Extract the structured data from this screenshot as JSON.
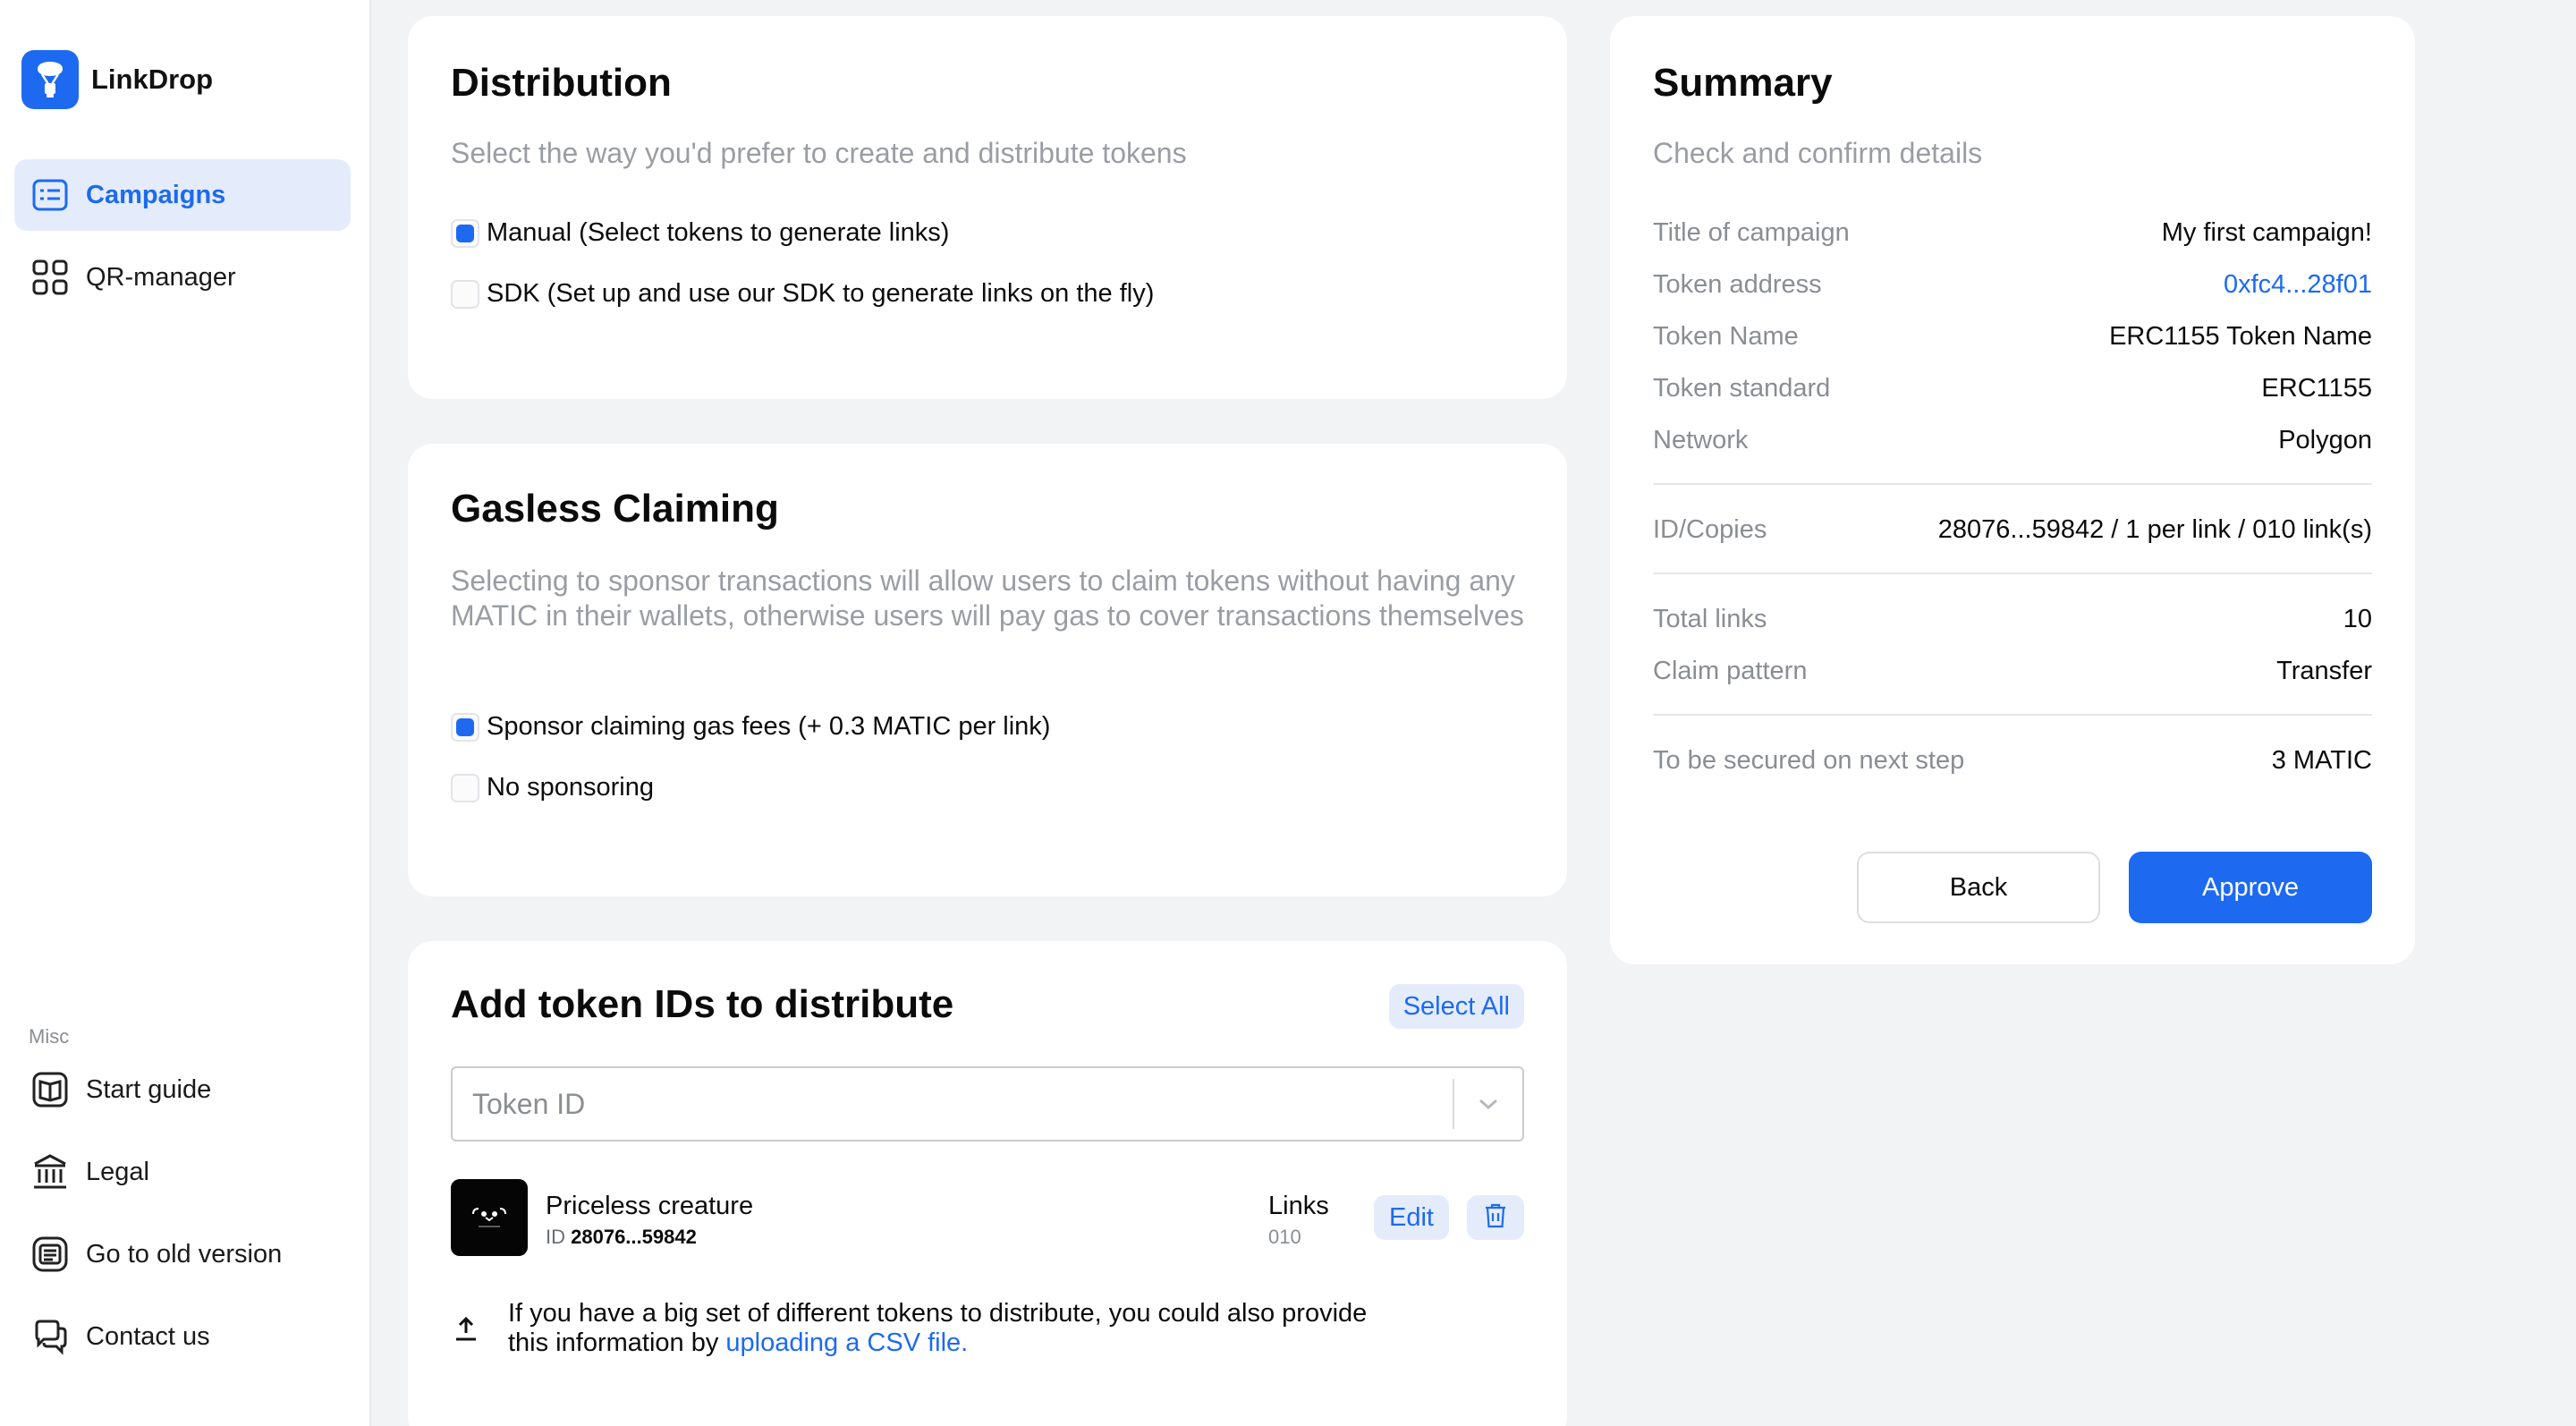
{
  "app": {
    "name": "LinkDrop"
  },
  "colors": {
    "accent": "#1d6af0",
    "accent_soft": "#e4ecfc",
    "muted": "#8a8d93"
  },
  "sidebar": {
    "items": [
      {
        "label": "Campaigns",
        "icon": "campaigns-icon",
        "active": true
      },
      {
        "label": "QR-manager",
        "icon": "qr-icon",
        "active": false
      }
    ],
    "misc_label": "Misc",
    "misc_items": [
      {
        "label": "Start guide",
        "icon": "book-icon"
      },
      {
        "label": "Legal",
        "icon": "bank-icon"
      },
      {
        "label": "Go to old version",
        "icon": "document-icon"
      },
      {
        "label": "Contact us",
        "icon": "chat-icon"
      }
    ]
  },
  "distribution": {
    "title": "Distribution",
    "subtitle": "Select the way you'd prefer to create and distribute tokens",
    "options": [
      {
        "label": "Manual (Select tokens to generate links)",
        "selected": true
      },
      {
        "label": "SDK (Set up and use our SDK to generate links on the fly)",
        "selected": false
      }
    ]
  },
  "gasless": {
    "title": "Gasless Claiming",
    "subtitle": "Selecting to sponsor transactions will allow users to claim tokens without having any MATIC in their wallets, otherwise users will pay gas to cover transactions themselves",
    "options": [
      {
        "label": "Sponsor claiming gas fees (+ 0.3 MATIC per link)",
        "selected": true
      },
      {
        "label": "No sponsoring",
        "selected": false
      }
    ]
  },
  "tokens": {
    "title": "Add token IDs to distribute",
    "select_all": "Select All",
    "input_placeholder": "Token ID",
    "item": {
      "name": "Priceless creature",
      "id_label": "ID",
      "id_value": "28076...59842",
      "links_label": "Links",
      "links_value": "010",
      "edit_label": "Edit"
    },
    "csv_text": "If you have a big set of different tokens to distribute, you could also provide this information by",
    "csv_link": "uploading a CSV file."
  },
  "summary": {
    "title": "Summary",
    "subtitle": "Check and confirm details",
    "rows": [
      {
        "key": "Title of campaign",
        "value": "My first campaign!"
      },
      {
        "key": "Token address",
        "value": "0xfc4...28f01"
      },
      {
        "key": "Token Name",
        "value": "ERC1155 Token Name"
      },
      {
        "key": "Token standard",
        "value": "ERC1155"
      },
      {
        "key": "Network",
        "value": "Polygon"
      },
      {
        "key": "ID/Copies",
        "value": "28076...59842 / 1 per link / 010 link(s)"
      },
      {
        "key": "Total links",
        "value": "10"
      },
      {
        "key": "Claim pattern",
        "value": "Transfer"
      },
      {
        "key": "To be secured on next step",
        "value": "3 MATIC"
      }
    ],
    "back_label": "Back",
    "approve_label": "Approve"
  }
}
